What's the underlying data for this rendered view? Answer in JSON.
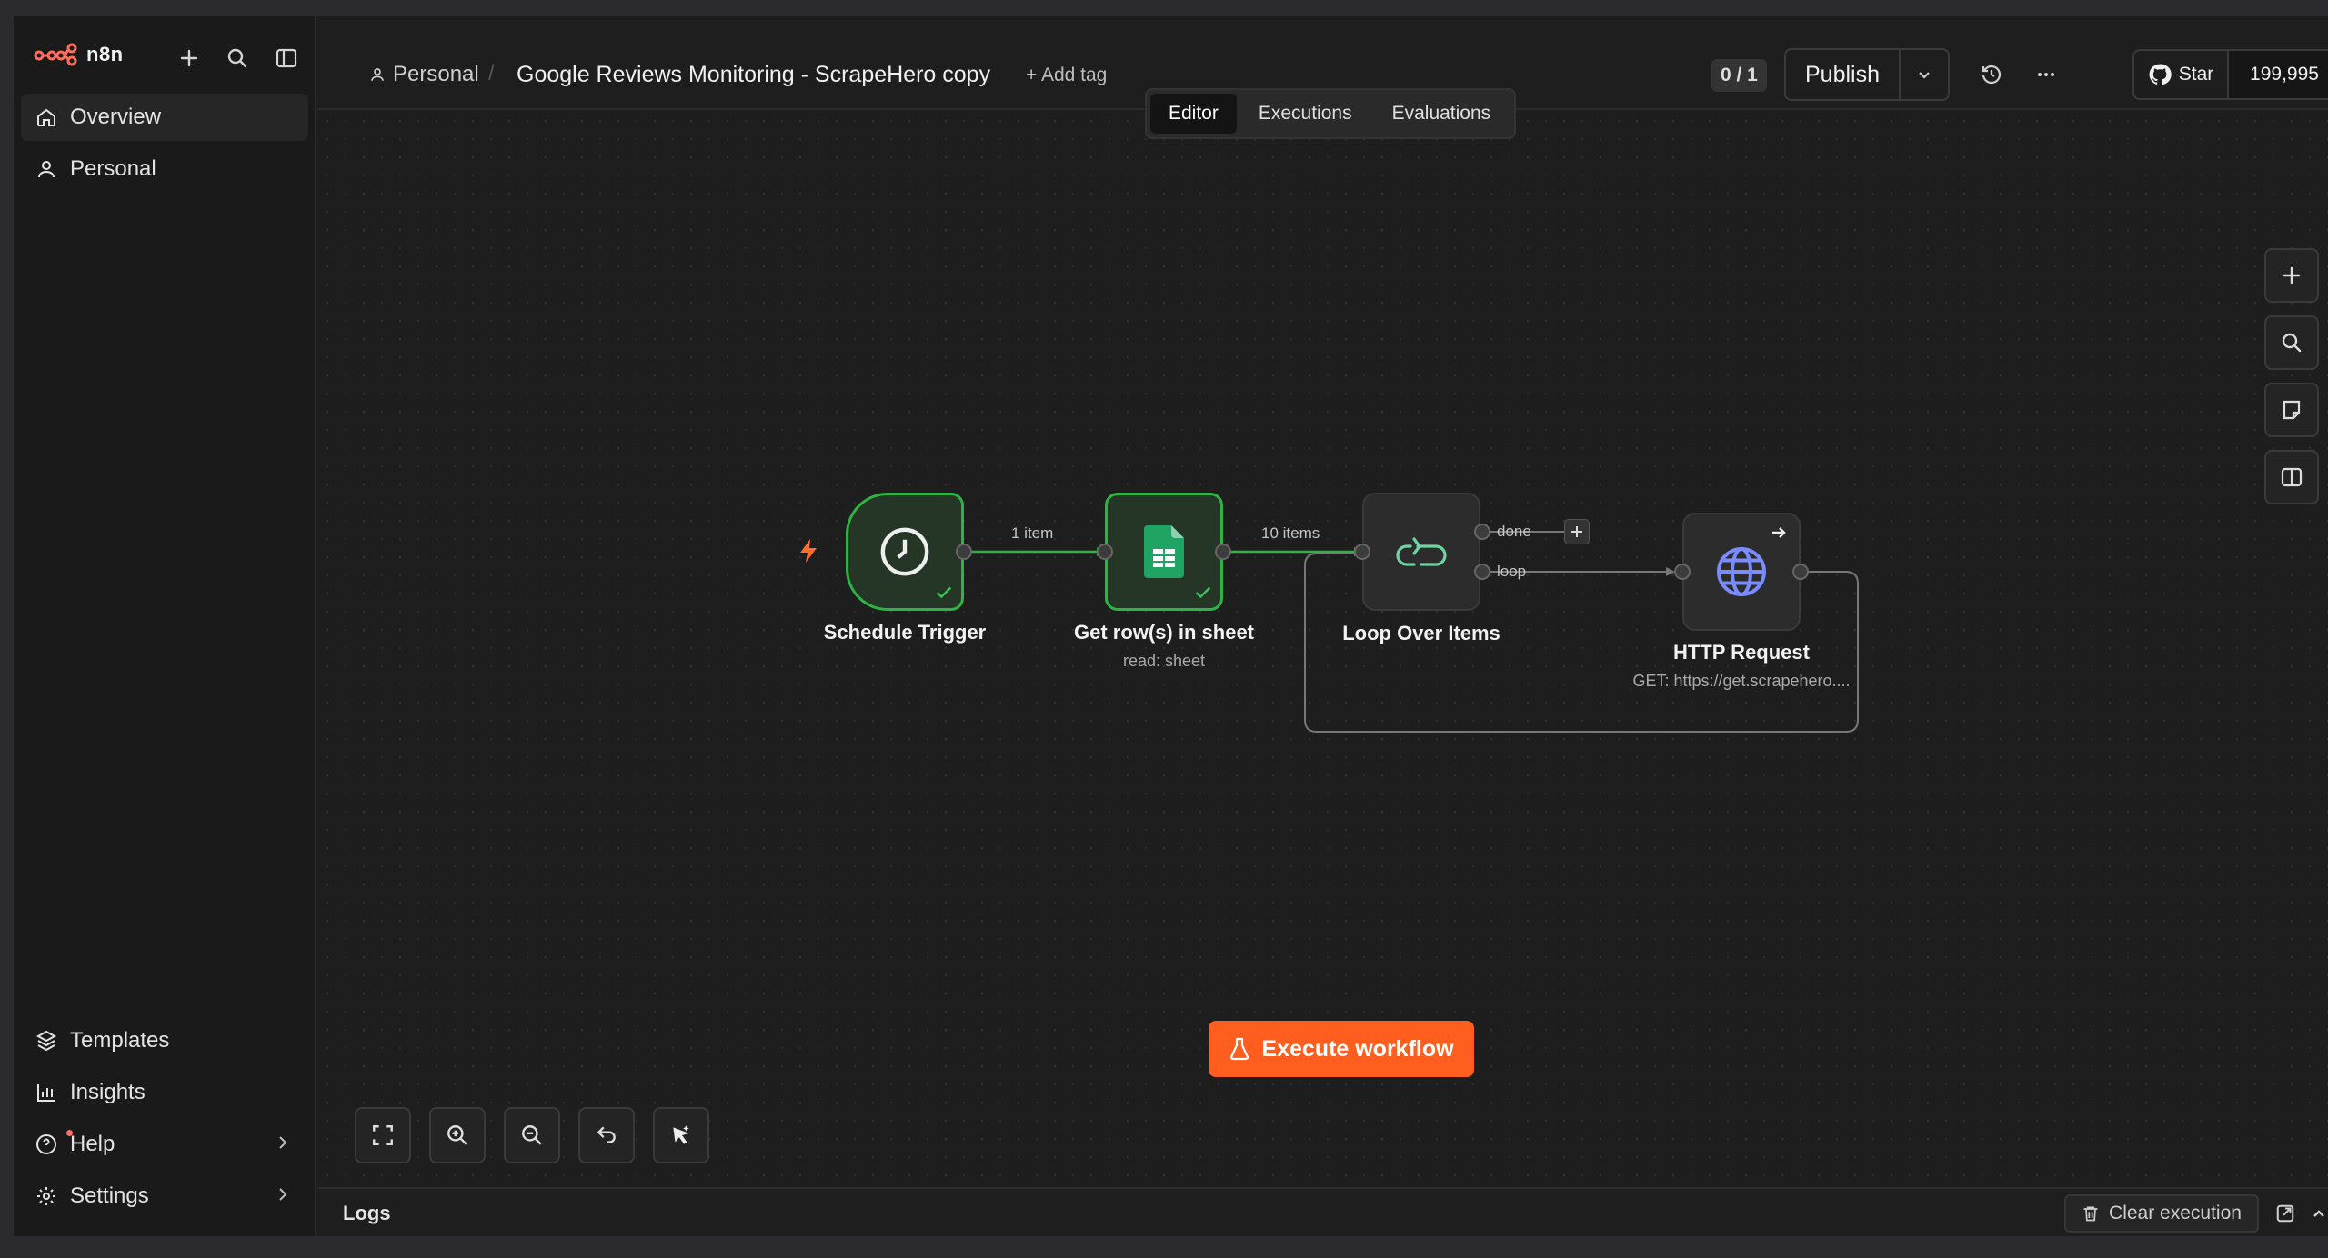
{
  "brand": {
    "name": "n8n",
    "accent": "#ff6d5a"
  },
  "sidebar": {
    "top_icons": [
      "plus-icon",
      "search-icon",
      "panel-toggle-icon"
    ],
    "items": [
      {
        "label": "Overview",
        "icon": "home-icon",
        "active": true
      },
      {
        "label": "Personal",
        "icon": "user-icon",
        "active": false
      }
    ],
    "bottom_items": [
      {
        "label": "Templates",
        "icon": "templates-icon"
      },
      {
        "label": "Insights",
        "icon": "chart-icon"
      },
      {
        "label": "Help",
        "icon": "help-icon"
      },
      {
        "label": "Settings",
        "icon": "gear-icon"
      }
    ]
  },
  "header": {
    "project": "Personal",
    "workflow_title": "Google Reviews Monitoring - ScrapeHero copy",
    "add_tag": "+ Add tag",
    "count_badge": "0 / 1",
    "publish": "Publish",
    "github_star": "Star",
    "github_count": "199,995"
  },
  "tabs": [
    {
      "label": "Editor",
      "active": true
    },
    {
      "label": "Executions",
      "active": false
    },
    {
      "label": "Evaluations",
      "active": false
    }
  ],
  "workflow": {
    "nodes": [
      {
        "name": "Schedule Trigger",
        "subtitle": "",
        "icon": "clock-icon",
        "status": "success"
      },
      {
        "name": "Get row(s) in sheet",
        "subtitle": "read: sheet",
        "icon": "google-sheets-icon",
        "status": "success"
      },
      {
        "name": "Loop Over Items",
        "subtitle": "",
        "icon": "loop-icon",
        "status": "idle"
      },
      {
        "name": "HTTP Request",
        "subtitle": "GET: https://get.scrapehero....",
        "icon": "globe-icon",
        "status": "idle"
      }
    ],
    "edges": [
      {
        "label": "1 item"
      },
      {
        "label": "10 items"
      },
      {
        "label": "done"
      },
      {
        "label": "loop"
      }
    ]
  },
  "execute_button": "Execute workflow",
  "logs": {
    "title": "Logs",
    "clear": "Clear execution"
  },
  "colors": {
    "success": "#2fb344",
    "execute": "#ff5e1f",
    "trigger_bolt": "#ff6d2d",
    "http_icon": "#7b8cff"
  }
}
